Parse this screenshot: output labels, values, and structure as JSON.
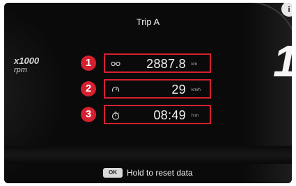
{
  "screen": {
    "title": "Trip A",
    "tachometer": {
      "value": "x1000",
      "unit": "rpm"
    },
    "gear": "1",
    "corner_badge": "i"
  },
  "trip_rows": [
    {
      "marker": "1",
      "icon": "odometer-icon",
      "value": "2887.8",
      "unit": "km"
    },
    {
      "marker": "2",
      "icon": "speedometer-icon",
      "value": "29",
      "unit": "km/h"
    },
    {
      "marker": "3",
      "icon": "stopwatch-icon",
      "value": "08:49",
      "unit": "h:m"
    }
  ],
  "footer": {
    "button_label": "OK",
    "hint": "Hold to reset data"
  },
  "colors": {
    "highlight": "#d5202f",
    "background": "#0a0a0a",
    "text": "#f2f2f2"
  }
}
